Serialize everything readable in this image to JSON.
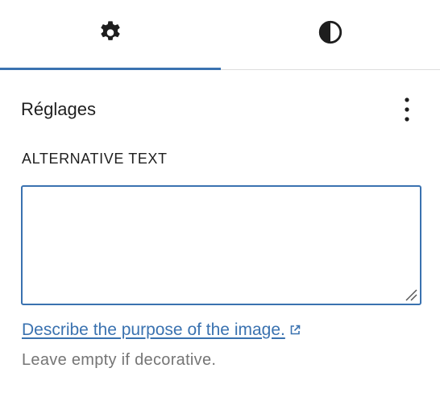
{
  "tabs": [
    {
      "name": "settings",
      "icon": "gear-icon",
      "active": true
    },
    {
      "name": "styles",
      "icon": "half-circle-contrast-icon",
      "active": false
    }
  ],
  "panel": {
    "title": "Réglages",
    "more_icon": "vertical-ellipsis-icon"
  },
  "alt_text_field": {
    "label": "ALTERNATIVE TEXT",
    "value": "",
    "placeholder": ""
  },
  "help": {
    "link_text": "Describe the purpose of the image.",
    "link_icon": "external-link-icon",
    "note": "Leave empty if decorative."
  },
  "colors": {
    "accent": "#3a72b0",
    "text": "#1e1e1e",
    "muted": "#757575",
    "divider": "#dddddd"
  }
}
